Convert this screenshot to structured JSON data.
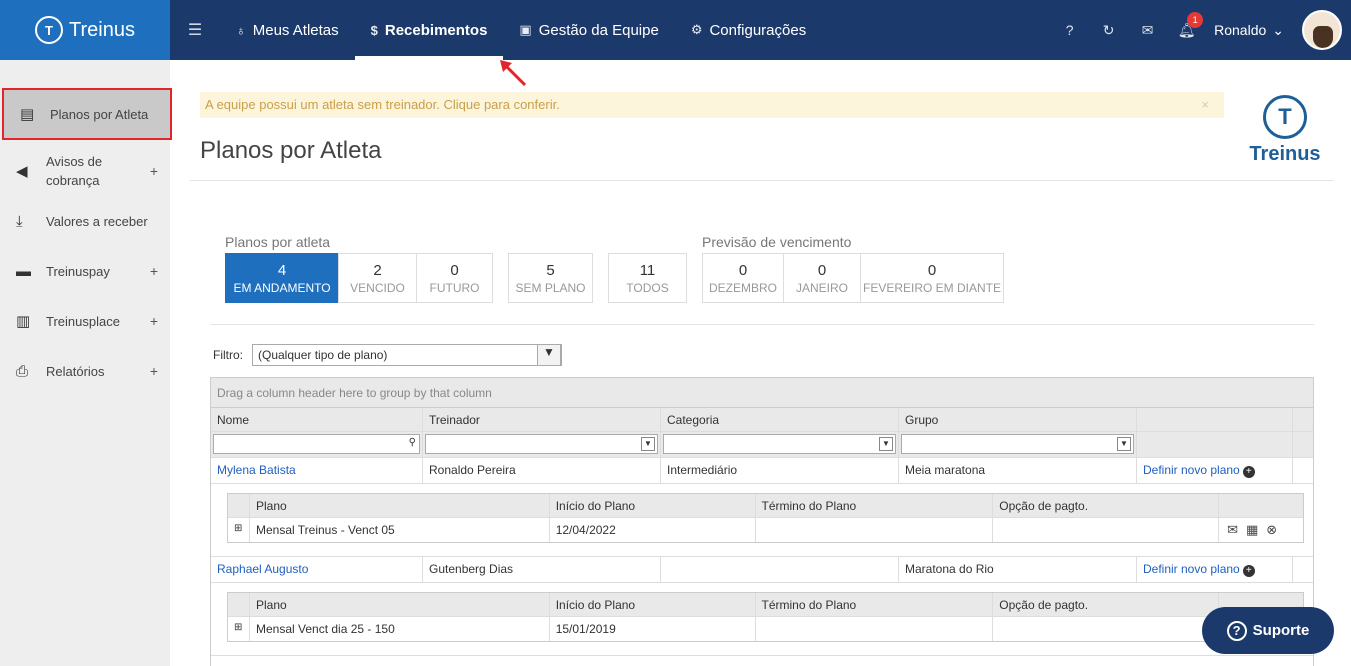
{
  "topbar": {
    "logo": "Treinus",
    "nav": [
      {
        "label": "Meus Atletas",
        "icon": "medal-icon"
      },
      {
        "label": "Recebimentos",
        "icon": "dollar-icon"
      },
      {
        "label": "Gestão da Equipe",
        "icon": "id-card-icon"
      },
      {
        "label": "Configurações",
        "icon": "gears-icon"
      }
    ],
    "notification_count": "1",
    "user_name": "Ronaldo"
  },
  "sidebar": {
    "items": [
      {
        "label": "Planos por Atleta",
        "icon": "plans-icon"
      },
      {
        "label": "Avisos de cobrança",
        "icon": "megaphone-icon"
      },
      {
        "label": "Valores a receber",
        "icon": "download-icon"
      },
      {
        "label": "Treinuspay",
        "icon": "wallet-icon"
      },
      {
        "label": "Treinusplace",
        "icon": "store-icon"
      },
      {
        "label": "Relatórios",
        "icon": "printer-icon"
      }
    ]
  },
  "main": {
    "alert": "A equipe possui um atleta sem treinador. Clique para conferir.",
    "title": "Planos por Atleta",
    "brand": "Treinus",
    "group1_label": "Planos por atleta",
    "group2_label": "Previsão de vencimento",
    "stats": [
      {
        "num": "4",
        "label": "EM ANDAMENTO"
      },
      {
        "num": "2",
        "label": "VENCIDO"
      },
      {
        "num": "0",
        "label": "FUTURO"
      },
      {
        "num": "5",
        "label": "SEM PLANO"
      },
      {
        "num": "11",
        "label": "TODOS"
      },
      {
        "num": "0",
        "label": "DEZEMBRO"
      },
      {
        "num": "0",
        "label": "JANEIRO"
      },
      {
        "num": "0",
        "label": "FEVEREIRO EM DIANTE"
      }
    ],
    "filter_label": "Filtro:",
    "filter_value": "(Qualquer tipo de plano)",
    "group_panel": "Drag a column header here to group by that column",
    "columns": [
      "Nome",
      "Treinador",
      "Categoria",
      "Grupo"
    ],
    "sub_columns": [
      "Plano",
      "Início do Plano",
      "Término do Plano",
      "Opção de pagto."
    ],
    "define_label": "Definir novo plano",
    "rows": [
      {
        "nome": "Mylena Batista",
        "treinador": "Ronaldo Pereira",
        "categoria": "Intermediário",
        "grupo": "Meia maratona",
        "plano": "Mensal Treinus - Venct 05",
        "inicio": "12/04/2022"
      },
      {
        "nome": "Raphael Augusto",
        "treinador": "Gutenberg Dias",
        "categoria": "",
        "grupo": "Maratona do Rio",
        "plano": "Mensal Venct dia 25 - 150",
        "inicio": "15/01/2019"
      }
    ],
    "support_label": "Suporte"
  }
}
